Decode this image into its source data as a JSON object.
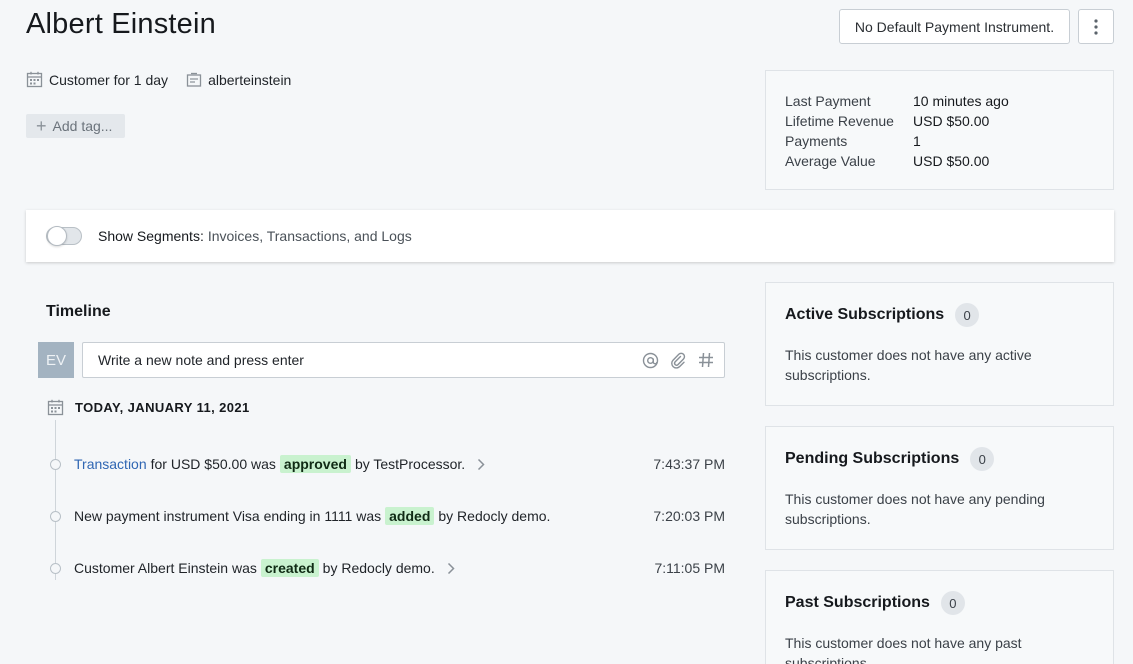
{
  "header": {
    "title": "Albert Einstein",
    "payment_button": "No Default Payment Instrument."
  },
  "meta": {
    "customer_since": "Customer for 1 day",
    "username": "alberteinstein"
  },
  "tags": {
    "add_label": "Add tag..."
  },
  "stats": [
    {
      "label": "Last Payment",
      "value": "10 minutes ago"
    },
    {
      "label": "Lifetime Revenue",
      "value": "USD $50.00"
    },
    {
      "label": "Payments",
      "value": "1"
    },
    {
      "label": "Average Value",
      "value": "USD $50.00"
    }
  ],
  "segments": {
    "label": "Show Segments:",
    "text": "Invoices, Transactions, and Logs"
  },
  "timeline": {
    "title": "Timeline",
    "avatar_initials": "EV",
    "note_placeholder": "Write a new note and press enter",
    "date_label": "TODAY, JANUARY 11, 2021",
    "events": [
      {
        "link": "Transaction",
        "before": "for USD $50.00 was",
        "badge": "approved",
        "after": "by TestProcessor.",
        "time": "7:43:37 PM"
      },
      {
        "link": "",
        "before": "New payment instrument Visa ending in 1111 was",
        "badge": "added",
        "after": "by Redocly demo.",
        "time": "7:20:03 PM"
      },
      {
        "link": "",
        "before": "Customer Albert Einstein was",
        "badge": "created",
        "after": "by Redocly demo.",
        "time": "7:11:05 PM"
      }
    ]
  },
  "subscriptions": [
    {
      "title": "Active Subscriptions",
      "count": "0",
      "description": "This customer does not have any active subscriptions."
    },
    {
      "title": "Pending Subscriptions",
      "count": "0",
      "description": "This customer does not have any pending subscriptions."
    },
    {
      "title": "Past Subscriptions",
      "count": "0",
      "description": "This customer does not have any past subscriptions."
    }
  ],
  "colors": {
    "link": "#2f66b3",
    "badge_bg": "#c9f2cf",
    "avatar_bg": "#a3b3c1"
  }
}
